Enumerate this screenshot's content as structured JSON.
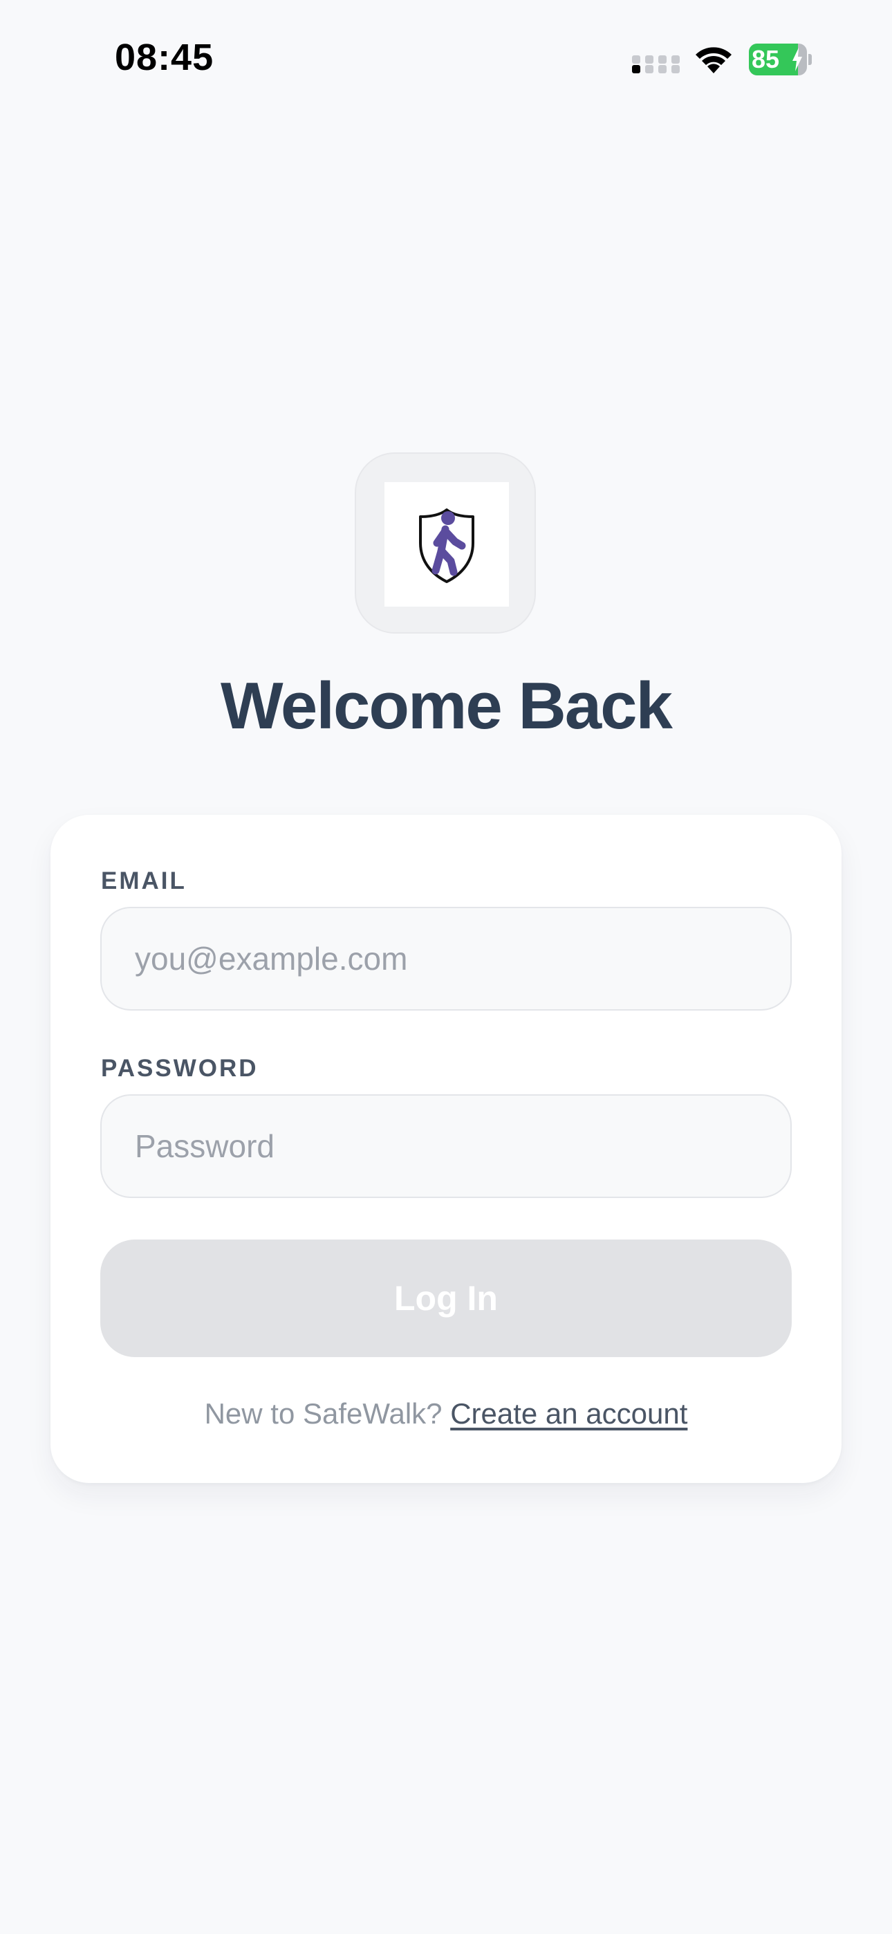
{
  "status_bar": {
    "time": "08:45",
    "battery_level": "85",
    "battery_fraction": 0.85,
    "battery_color": "#34c759",
    "icons": [
      "cellular-signal-icon",
      "wifi-icon",
      "battery-charging-icon"
    ]
  },
  "logo": {
    "icon": "walking-person-shield-icon",
    "accent_color": "#5b4c9e"
  },
  "page": {
    "title": "Welcome Back",
    "title_color": "#2e3e53"
  },
  "form": {
    "email_label": "EMAIL",
    "email_placeholder": "you@example.com",
    "email_value": "",
    "password_label": "PASSWORD",
    "password_placeholder": "Password",
    "password_value": "",
    "login_label": "Log In",
    "login_disabled": true
  },
  "signup": {
    "prompt": "New to SafeWalk?",
    "link_label": "Create an account"
  }
}
